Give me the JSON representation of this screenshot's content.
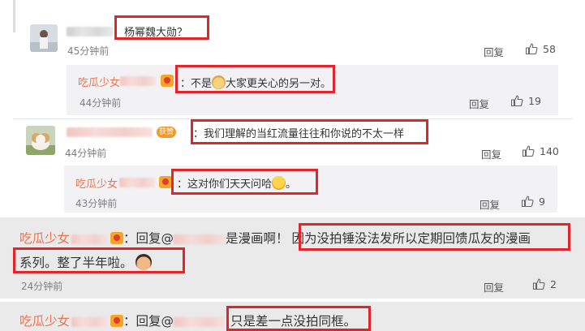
{
  "comments": [
    {
      "text": "杨幂魏大勋？",
      "time": "45分钟前",
      "reply_label": "回复",
      "likes": "58",
      "sub": {
        "username": "吃瓜少女",
        "text": "：不是",
        "text_after": "大家更关心的另一对。",
        "time": "44分钟前",
        "reply_label": "回复",
        "likes": "19"
      }
    },
    {
      "badge": "获赞",
      "text": "：我们理解的当红流量往往和你说的不太一样",
      "time": "44分钟前",
      "reply_label": "回复",
      "likes": "140",
      "sub": {
        "username": "吃瓜少女",
        "text": "：这对你们天天问哈",
        "text_after": "。",
        "time": "43分钟前",
        "reply_label": "回复",
        "likes": "9"
      }
    },
    {
      "username": "吃瓜少女",
      "reply_prefix": "：回复@",
      "text_pre": "是漫画啊！",
      "text_hl": "因为没拍锤没法发所以定期回馈瓜友的漫画",
      "text_line2": "系列。整了半年啦。",
      "time": "24分钟前",
      "reply_label": "回复",
      "likes": "2"
    },
    {
      "username": "吃瓜少女",
      "reply_prefix": "：回复@",
      "text": "只是差一点没拍同框。"
    }
  ],
  "icons": {
    "like": "thumbs-up-icon",
    "emoji_dog": "dog-face-emoji-icon",
    "emoji_yum": "yum-face-emoji-icon",
    "emoji_cool": "cool-face-emoji-icon",
    "badge": "crown-badge-icon"
  },
  "colors": {
    "username": "#eb7350",
    "highlight_box": "#e2252b",
    "reply_bg": "#f2f2f5",
    "quote_bg": "#eaeaea"
  }
}
